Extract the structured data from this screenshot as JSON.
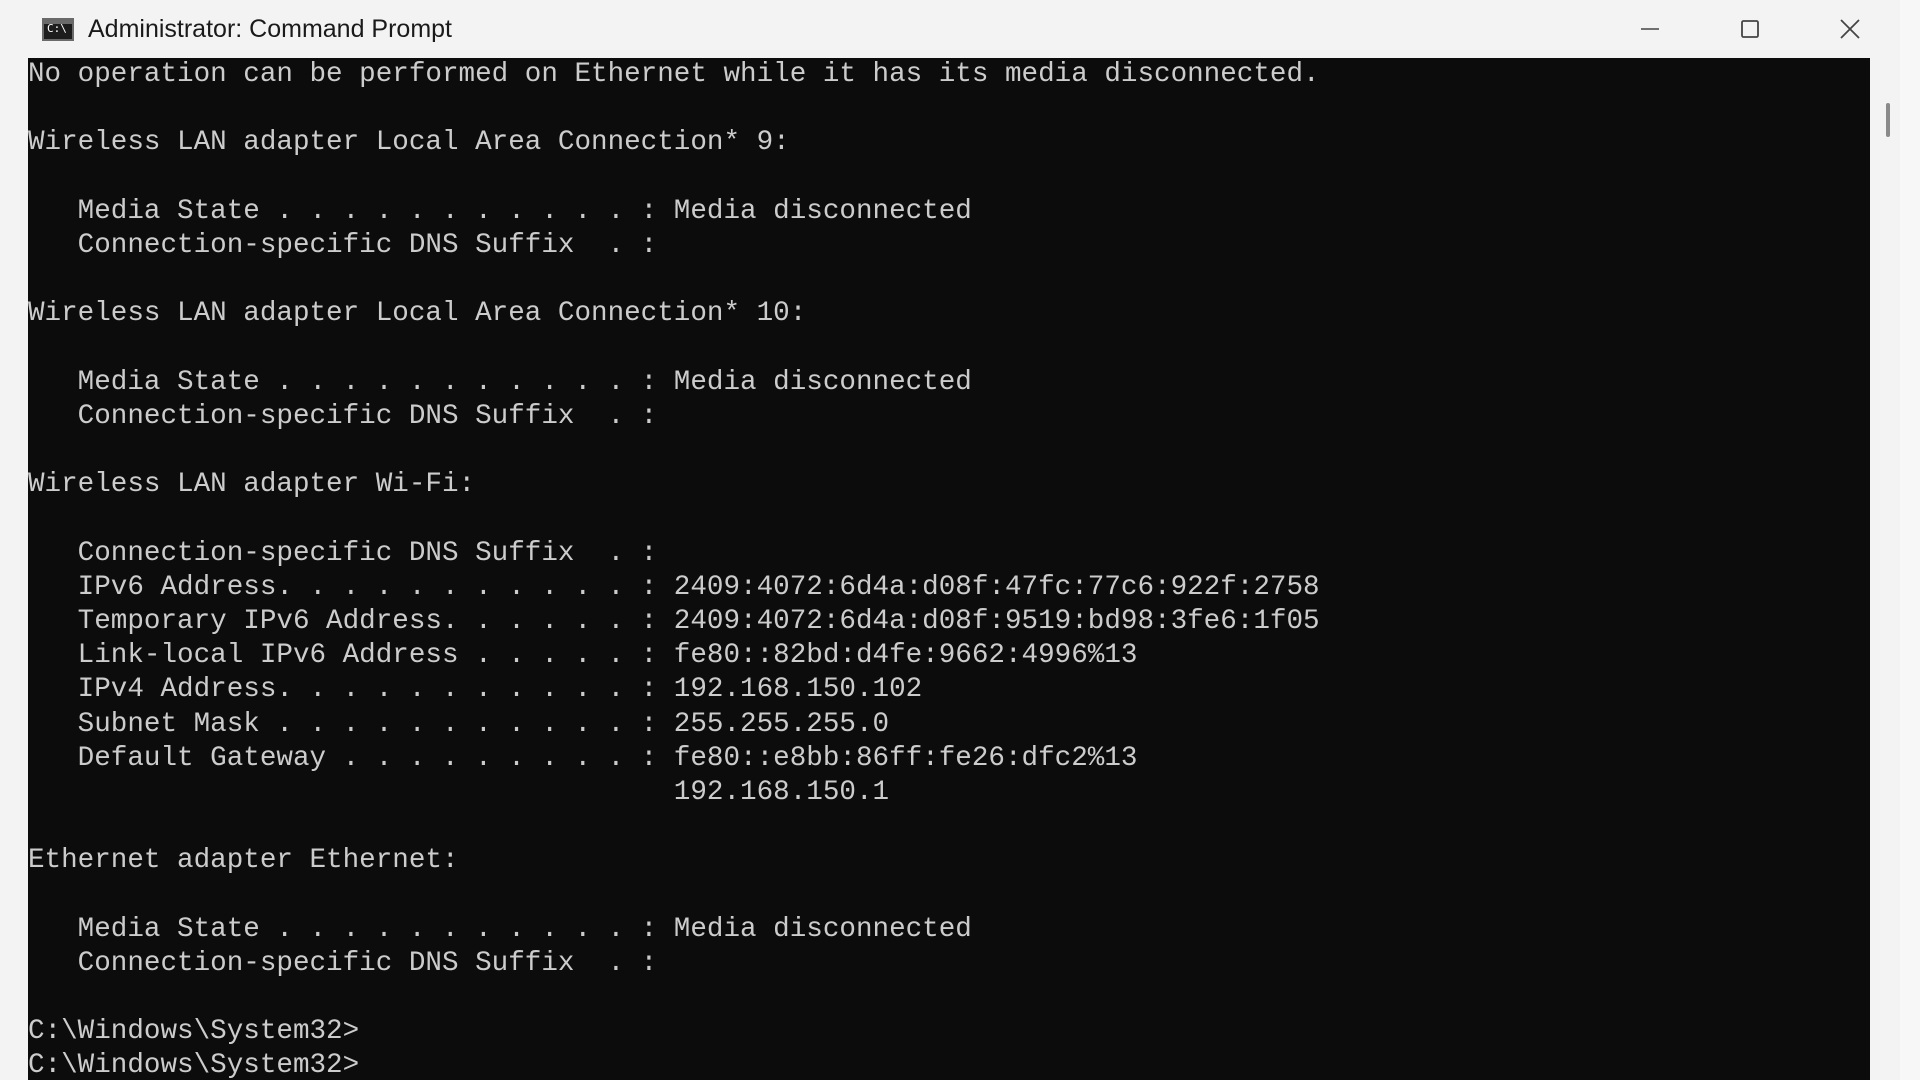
{
  "window": {
    "title": "Administrator: Command Prompt",
    "icon": "cmd-icon",
    "icon_glyph": "C:\\",
    "controls": {
      "minimize": "minimize-icon",
      "maximize": "maximize-icon",
      "close": "close-icon"
    }
  },
  "console": {
    "text_color": "#cccccc",
    "background": "#0c0c0c",
    "lines": [
      "No operation can be performed on Ethernet while it has its media disconnected.",
      "",
      "Wireless LAN adapter Local Area Connection* 9:",
      "",
      "   Media State . . . . . . . . . . . : Media disconnected",
      "   Connection-specific DNS Suffix  . :",
      "",
      "Wireless LAN adapter Local Area Connection* 10:",
      "",
      "   Media State . . . . . . . . . . . : Media disconnected",
      "   Connection-specific DNS Suffix  . :",
      "",
      "Wireless LAN adapter Wi-Fi:",
      "",
      "   Connection-specific DNS Suffix  . :",
      "   IPv6 Address. . . . . . . . . . . : 2409:4072:6d4a:d08f:47fc:77c6:922f:2758",
      "   Temporary IPv6 Address. . . . . . : 2409:4072:6d4a:d08f:9519:bd98:3fe6:1f05",
      "   Link-local IPv6 Address . . . . . : fe80::82bd:d4fe:9662:4996%13",
      "   IPv4 Address. . . . . . . . . . . : 192.168.150.102",
      "   Subnet Mask . . . . . . . . . . . : 255.255.255.0",
      "   Default Gateway . . . . . . . . . : fe80::e8bb:86ff:fe26:dfc2%13",
      "                                       192.168.150.1",
      "",
      "Ethernet adapter Ethernet:",
      "",
      "   Media State . . . . . . . . . . . : Media disconnected",
      "   Connection-specific DNS Suffix  . :",
      "",
      "C:\\Windows\\System32>",
      "C:\\Windows\\System32>"
    ]
  }
}
